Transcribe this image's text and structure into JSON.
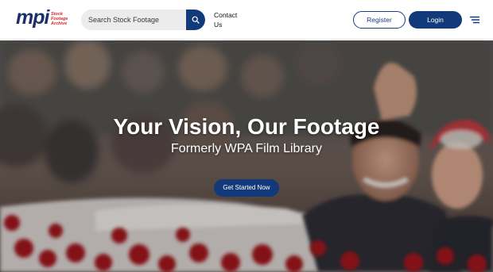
{
  "logo": {
    "wordmark": "mpi",
    "line1": "Stock",
    "line2": "Footage",
    "line3": "Archive",
    "colors": {
      "wordmark": "#1b2f6b",
      "tagline": "#d9262b"
    }
  },
  "search": {
    "placeholder": "Search Stock Footage",
    "icon": "search-icon"
  },
  "nav": {
    "contact_line1": "Contact",
    "contact_line2": "Us",
    "register_label": "Register",
    "login_label": "Login",
    "menu_icon": "hamburger-menu-icon"
  },
  "hero": {
    "title": "Your Vision, Our Footage",
    "subtitle": "Formerly WPA Film Library",
    "cta_label": "Get Started Now"
  },
  "colors": {
    "brand_navy": "#123a7a",
    "text_dark": "#111111",
    "white": "#ffffff"
  }
}
